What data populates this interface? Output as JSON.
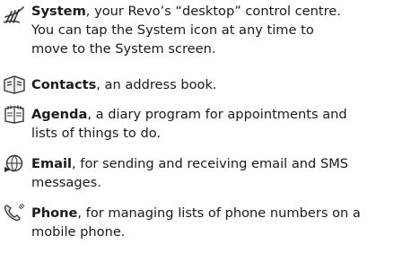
{
  "entries": [
    {
      "icon": "system-icon",
      "term": "System",
      "lines": [
        ", your Revo’s “desktop” control centre.",
        "You can tap the System icon at any time to",
        "move to the System screen."
      ]
    },
    {
      "icon": "contacts-icon",
      "term": "Contacts",
      "lines": [
        ", an address book."
      ]
    },
    {
      "icon": "agenda-icon",
      "term": "Agenda",
      "lines": [
        ", a diary program for appointments and",
        "lists of things to do."
      ]
    },
    {
      "icon": "email-icon",
      "term": "Email",
      "lines": [
        ", for sending and receiving email and SMS",
        "messages."
      ]
    },
    {
      "icon": "phone-icon",
      "term": "Phone",
      "lines": [
        ", for managing lists of phone numbers on a",
        "mobile phone."
      ]
    }
  ]
}
